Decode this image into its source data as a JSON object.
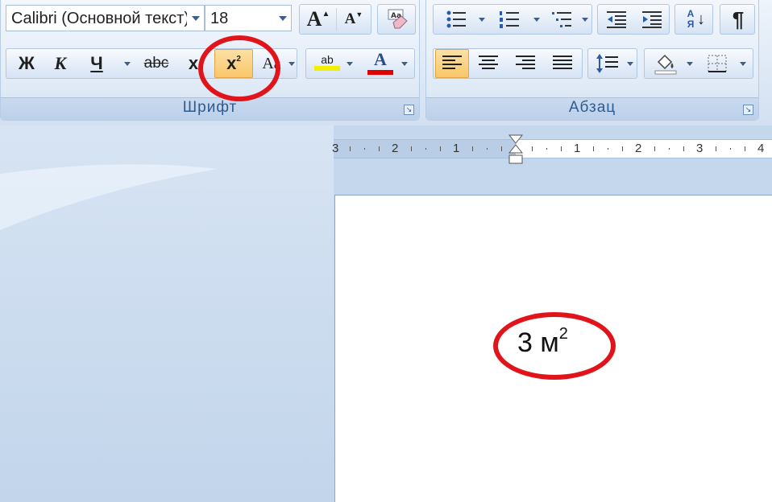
{
  "ribbon": {
    "font_group": {
      "label": "Шрифт",
      "font_name": "Calibri (Основной текст)",
      "font_size": "18",
      "grow_glyph": "A",
      "shrink_glyph": "A",
      "bold": "Ж",
      "italic": "К",
      "underline": "Ч",
      "strikethrough": "abc",
      "subscript": "x",
      "superscript": "x",
      "superscript_exp": "2",
      "change_case": "Aa",
      "highlight_glyph": "ab",
      "font_color_glyph": "A"
    },
    "paragraph_group": {
      "label": "Абзац",
      "sort_glyph": "А Я",
      "pilcrow": "¶"
    },
    "launcher_glyph": "↘"
  },
  "ruler": {
    "left_labels": [
      "3",
      "2",
      "1"
    ],
    "right_labels": [
      "1",
      "2",
      "3",
      "4"
    ]
  },
  "document": {
    "text": "3 м",
    "superscript": "2"
  },
  "colors": {
    "accent_highlight": "#f9c66a",
    "annotation_circle": "#e2141b",
    "highlight_yellow": "#f4ee00",
    "font_color_red": "#e00000"
  }
}
